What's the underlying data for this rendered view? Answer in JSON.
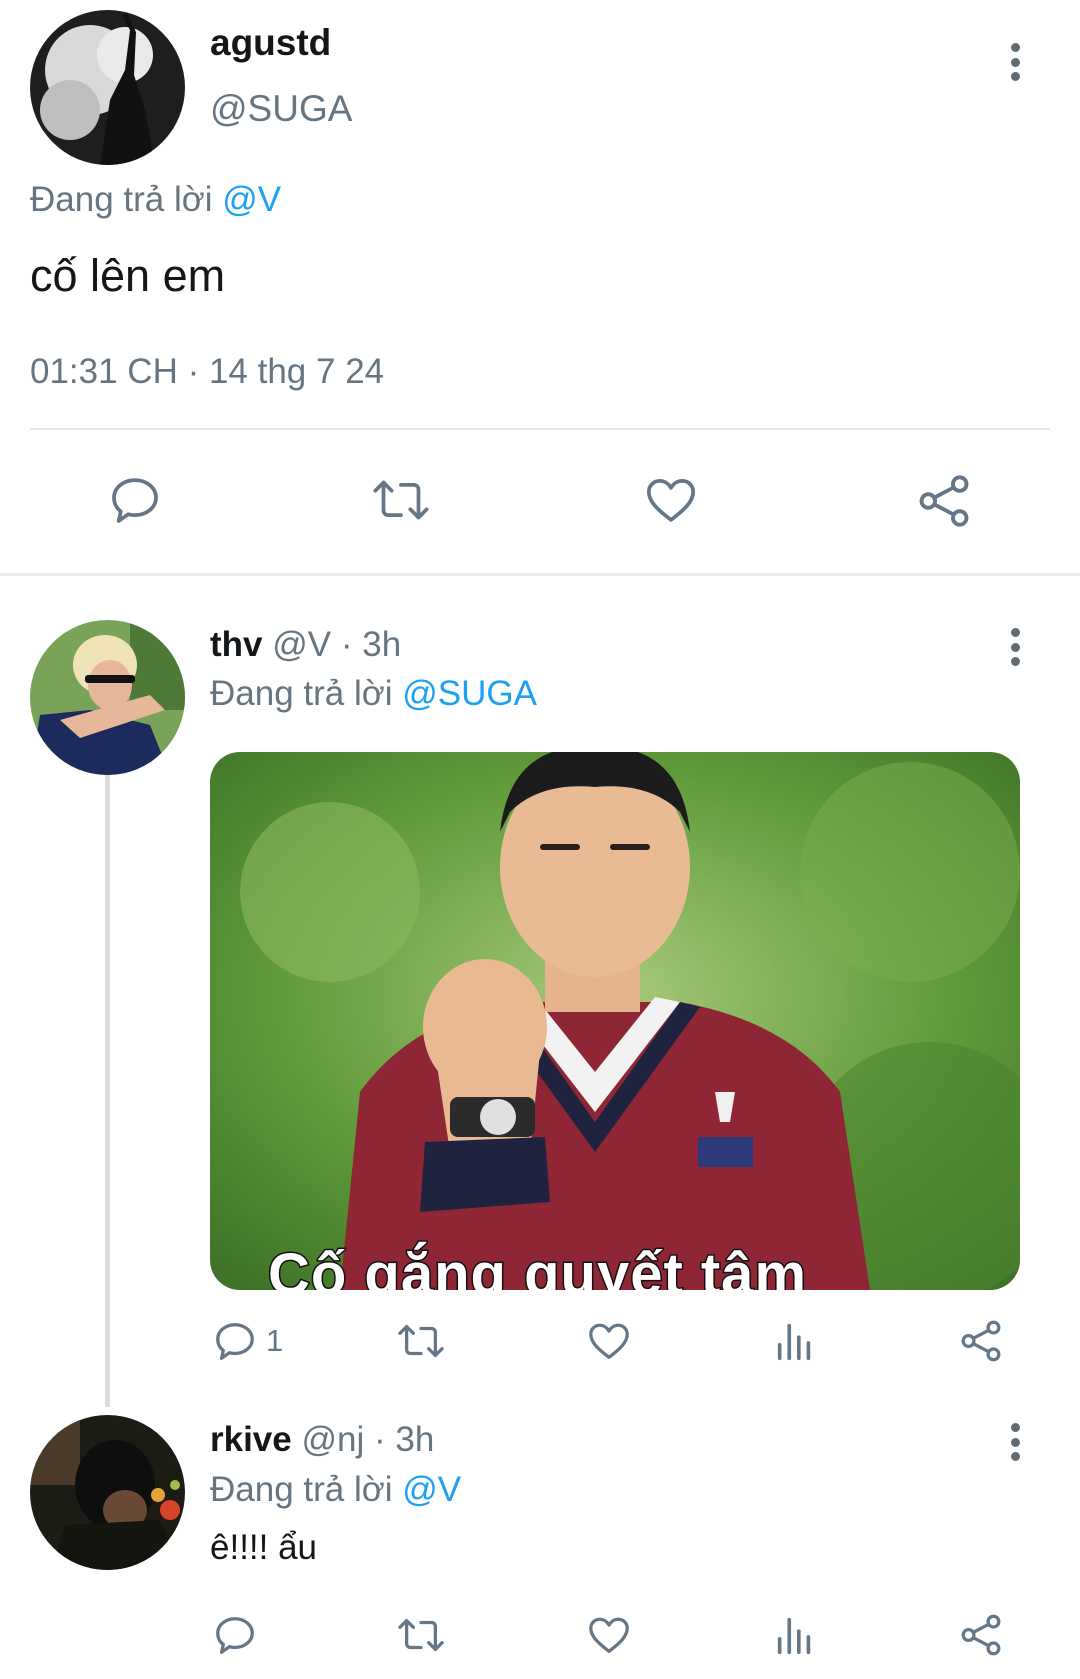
{
  "main_tweet": {
    "name": "agustd",
    "handle": "@SUGA",
    "replying_prefix": "Đang trả lời",
    "replying_to": "@V",
    "text": "cố lên em",
    "meta": "01:31 CH · 14 thg 7 24",
    "actions": [
      "reply-icon",
      "retweet-icon",
      "like-icon",
      "share-icon"
    ]
  },
  "replies": [
    {
      "name": "thv",
      "handle": "@V",
      "time": "· 3h",
      "replying_prefix": "Đang trả lời",
      "replying_to": "@SUGA",
      "media_caption": "Cố gắng quyết tâm",
      "reply_count": "1",
      "actions": [
        "reply-icon",
        "retweet-icon",
        "like-icon",
        "views-icon",
        "share-icon"
      ]
    },
    {
      "name": "rkive",
      "handle": "@nj",
      "time": "· 3h",
      "replying_prefix": "Đang trả lời",
      "replying_to": "@V",
      "text": "ê!!!! ẩu",
      "actions": [
        "reply-icon",
        "retweet-icon",
        "like-icon",
        "views-icon",
        "share-icon"
      ]
    }
  ],
  "colors": {
    "mention": "#1da1f2",
    "secondary_text": "#66757f",
    "icon": "#657786"
  }
}
